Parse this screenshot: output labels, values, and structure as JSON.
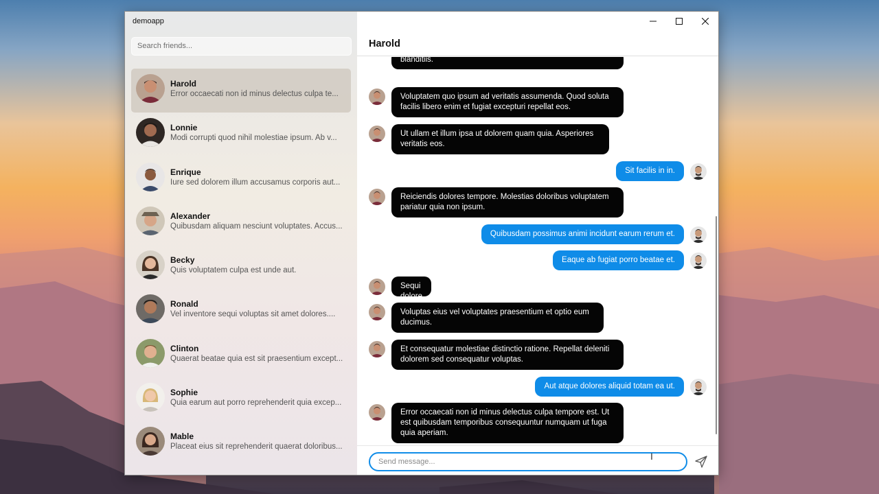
{
  "window": {
    "title": "demoapp"
  },
  "search": {
    "placeholder": "Search friends..."
  },
  "friends": [
    {
      "name": "Harold",
      "preview": "Error occaecati non id minus delectus culpa te...",
      "avatar_color": "#7a4a3a",
      "active": true
    },
    {
      "name": "Lonnie",
      "preview": "Modi corrupti quod nihil molestiae ipsum. Ab v...",
      "avatar_color": "#3c2a22"
    },
    {
      "name": "Enrique",
      "preview": "Iure sed dolorem illum accusamus corporis aut...",
      "avatar_color": "#5a3a2b"
    },
    {
      "name": "Alexander",
      "preview": "Quibusdam aliquam nesciunt voluptates. Accus...",
      "avatar_color": "#8d7a62"
    },
    {
      "name": "Becky",
      "preview": "Quis voluptatem culpa est unde aut.",
      "avatar_color": "#4d3b2e"
    },
    {
      "name": "Ronald",
      "preview": "Vel inventore sequi voluptas sit amet dolores....",
      "avatar_color": "#3b3532"
    },
    {
      "name": "Clinton",
      "preview": "Quaerat beatae quia est sit praesentium except...",
      "avatar_color": "#6b7a55"
    },
    {
      "name": "Sophie",
      "preview": "Quia earum aut porro reprehenderit quia excep...",
      "avatar_color": "#c9b08a"
    },
    {
      "name": "Mable",
      "preview": "Placeat eius sit reprehenderit quaerat doloribus...",
      "avatar_color": "#5a4038"
    }
  ],
  "chat": {
    "title": "Harold",
    "messages": [
      {
        "dir": "in",
        "text": "blanditiis."
      },
      {
        "dir": "in",
        "text": "Voluptatem quo ipsum ad veritatis assumenda. Quod soluta facilis libero enim et fugiat excepturi repellat eos."
      },
      {
        "dir": "in",
        "text": "Ut ullam et illum ipsa ut dolorem quam quia. Asperiores veritatis eos."
      },
      {
        "dir": "out",
        "text": "Sit facilis in in."
      },
      {
        "dir": "in",
        "text": "Reiciendis dolores tempore. Molestias doloribus voluptatem pariatur quia non ipsum."
      },
      {
        "dir": "out",
        "text": "Quibusdam possimus animi incidunt earum rerum et."
      },
      {
        "dir": "out",
        "text": "Eaque ab fugiat porro beatae et."
      },
      {
        "dir": "in",
        "text": "Sequi dolore esse."
      },
      {
        "dir": "in",
        "text": "Voluptas eius vel voluptates praesentium et optio eum ducimus."
      },
      {
        "dir": "in",
        "text": "Et consequatur molestiae distinctio ratione. Repellat deleniti dolorem sed consequatur voluptas."
      },
      {
        "dir": "out",
        "text": "Aut atque dolores aliquid totam ea ut."
      },
      {
        "dir": "in",
        "text": "Error occaecati non id minus delectus culpa tempore est. Ut est quibusdam temporibus consequuntur numquam ut fuga quia aperiam."
      }
    ],
    "input_placeholder": "Send message...",
    "accent_color": "#0f8ce8"
  },
  "icons": {
    "minimize": "minimize-icon",
    "maximize": "maximize-icon",
    "close": "close-icon",
    "send": "send-icon",
    "cursor": "text-cursor-icon"
  }
}
